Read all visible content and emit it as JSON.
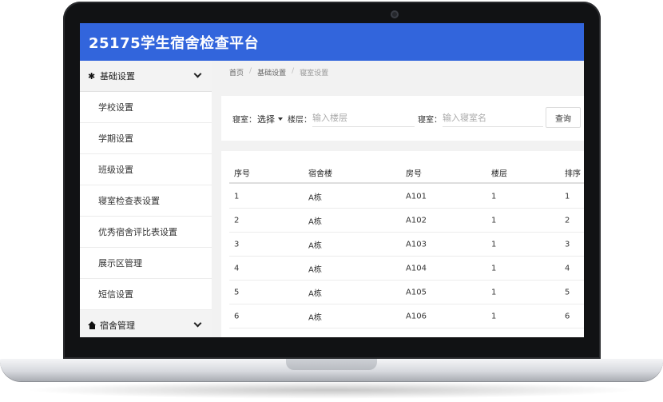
{
  "app": {
    "title": "25175学生宿舍检查平台"
  },
  "sidebar": {
    "groups": [
      {
        "label": "基础设置",
        "icon": "gear-icon",
        "expanded": true,
        "items": [
          {
            "label": "学校设置"
          },
          {
            "label": "学期设置"
          },
          {
            "label": "班级设置"
          },
          {
            "label": "寝室检查表设置"
          },
          {
            "label": "优秀宿舍评比表设置"
          },
          {
            "label": "展示区管理"
          },
          {
            "label": "短信设置"
          }
        ]
      },
      {
        "label": "宿舍管理",
        "icon": "home-icon",
        "expanded": false
      }
    ]
  },
  "breadcrumb": {
    "items": [
      "首页",
      "基础设置",
      "寝室设置"
    ],
    "separator": "/"
  },
  "filters": {
    "dorm_label": "寝室：",
    "select_value": "选择",
    "floor_label": "楼层：",
    "floor_placeholder": "输入楼层",
    "room_label": "寝室：",
    "room_placeholder": "输入寝室名",
    "query_button": "查询"
  },
  "table": {
    "headers": [
      "序号",
      "宿舍楼",
      "房号",
      "楼层",
      "排序"
    ],
    "rows": [
      [
        "1",
        "A栋",
        "A101",
        "1",
        "1"
      ],
      [
        "2",
        "A栋",
        "A102",
        "1",
        "2"
      ],
      [
        "3",
        "A栋",
        "A103",
        "1",
        "3"
      ],
      [
        "4",
        "A栋",
        "A104",
        "1",
        "4"
      ],
      [
        "5",
        "A栋",
        "A105",
        "1",
        "5"
      ],
      [
        "6",
        "A栋",
        "A106",
        "1",
        "6"
      ]
    ]
  },
  "colors": {
    "topbar": "#3265dc",
    "background": "#f2f2f2"
  }
}
